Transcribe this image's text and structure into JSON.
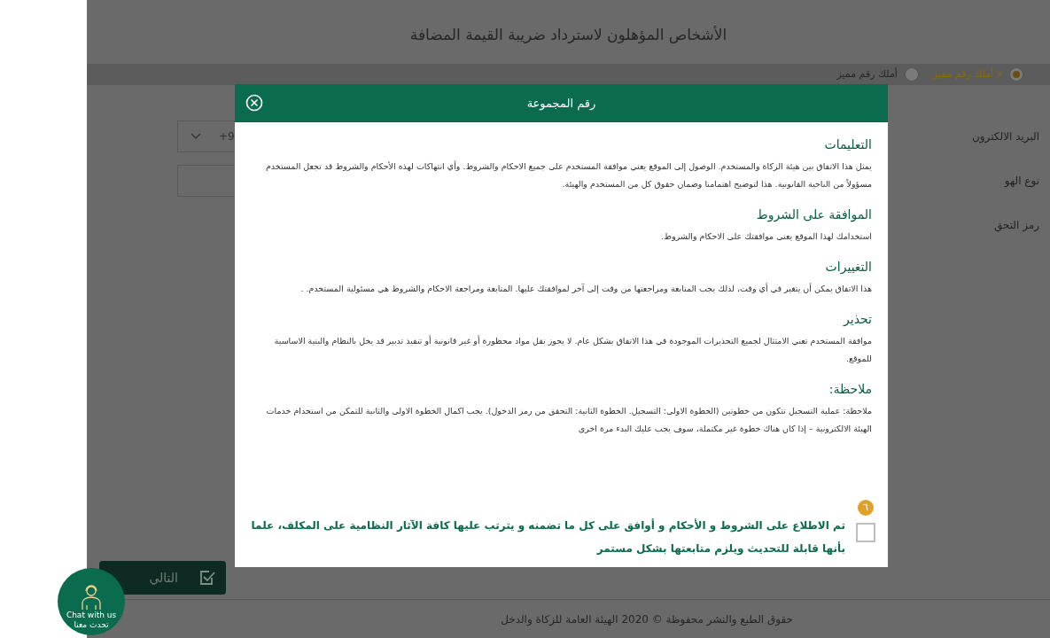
{
  "page": {
    "title": "الأشخاص المؤهلون لاسترداد ضريبة القيمة المضافة",
    "options": [
      {
        "label": "لا أملك رقم مميز",
        "selected": true
      },
      {
        "label": "أملك رقم مميز",
        "selected": false
      }
    ],
    "fields": [
      {
        "label": "البريد الالكترون",
        "value": "+9",
        "kind": "select"
      },
      {
        "label": "نوع الهو",
        "kind": "text"
      },
      {
        "label": "رمز التحق"
      }
    ],
    "next_button": "التالي",
    "footer": "حقوق الطبع والنشر محفوظة © 2020 الهيئة العامة للزكاة والدخل"
  },
  "modal": {
    "title": "رقم المجموعة",
    "sections": [
      {
        "heading": "التعليمات",
        "text": "يمثل هذا الاتفاق بين هيئة الزكاة والمستخدم. الوصول إلى الموقع يعني موافقة المستخدم على جميع الاحكام والشروط. وأي انتهاكات لهذه الأحكام والشروط قد تجعل المستخدم مسؤولاً من الناحية القانونية. هذا لتوضيح اهتمامنا وضمان حقوق كل من المستخدم والهيئة."
      },
      {
        "heading": "الموافقة على الشروط",
        "text": "استخدامك لهذا الموقع يعنى موافقتك على الاحكام والشروط."
      },
      {
        "heading": "التغييرات",
        "text": "هذا الاتفاق يمكن أن يتغير في أي وقت، لذلك يجب المتابعة ومراجعتها من وقت إلى آخر لموافقتك عليها. المتابعة ومراجعة الاحكام والشروط هي مسئولية المستخدم. ."
      },
      {
        "heading": "تحذير",
        "text": "موافقة المستخدم تعني الامتثال لجميع التحذيرات الموجودة في هذا الاتفاق بشكل عام. لا يجوز نقل مواد محظورة أو غير قانونية أو تنفيذ تدبير قد يخل بالنظام والبنية الاساسية للموقع."
      },
      {
        "heading": "ملاحظة:",
        "text": "ملاحظة: عملية التسجيل تتكون من خطوتين (الخطوة الاولى: التسجيل. الخطوة الثانية: التحقق من رمز الدخول). يجب اكمال الخطوة الاولى والثانية للتمكن من استخدام خدمات الهيئة الالكترونية – إذا كان هناك خطوة غير مكتملة، سوف يجب عليك البدء مرة اخرى"
      }
    ],
    "step_badge": "٦",
    "agreement": {
      "checked": false,
      "text": "تم الاطلاع على الشروط و الأحكام و أوافق على كل ما تضمنه و يترتب عليها كافة الآثار النظامية على المكلف، علما بأنها قابلة للتحديث ويلزم متابعتها بشكل مستمر"
    }
  },
  "chat": {
    "label": "Chat with us",
    "label_ar": "تحدث معنا"
  }
}
